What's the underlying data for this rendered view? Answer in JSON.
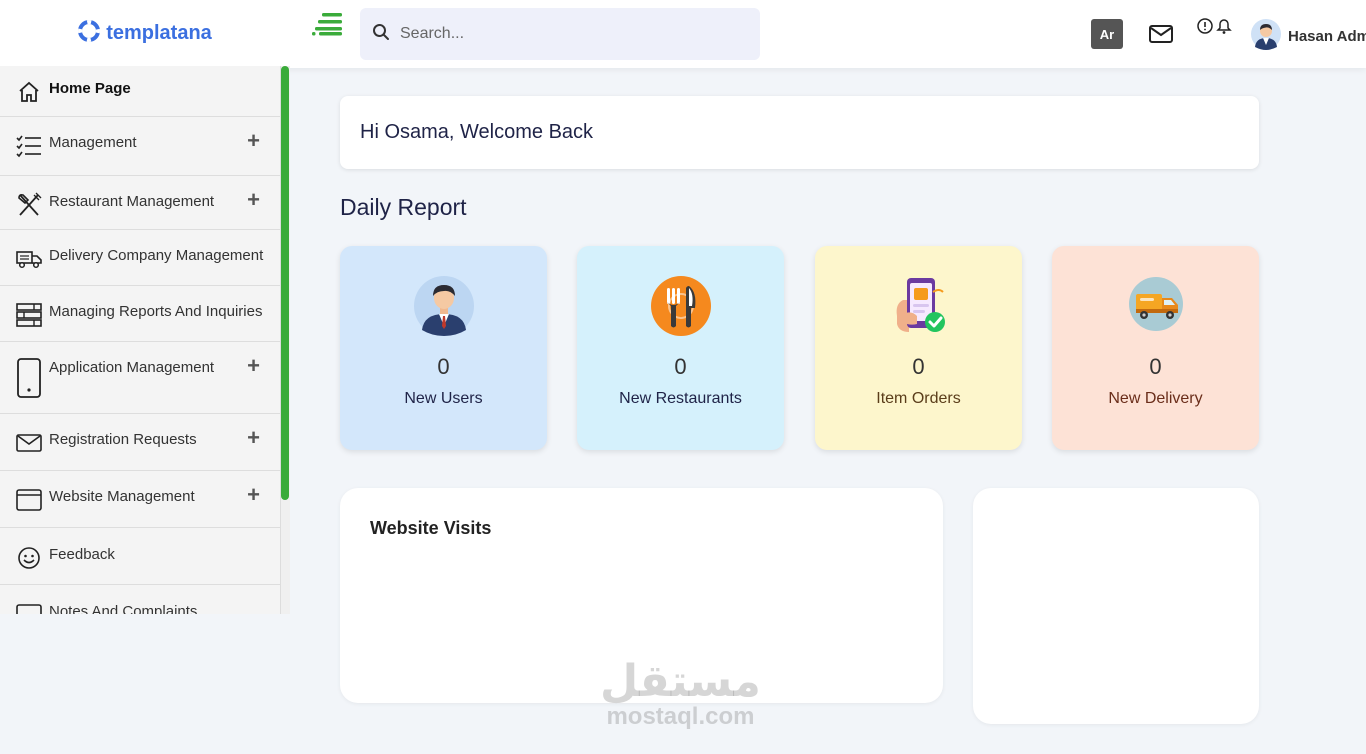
{
  "brand": {
    "name": "templatana",
    "color": "#3b6fe0"
  },
  "header": {
    "search_placeholder": "Search...",
    "lang_label": "Ar",
    "user_name": "Hasan Admin"
  },
  "sidebar": {
    "accent": "#3aab3a",
    "items": [
      {
        "label": "Home Page",
        "icon": "home-icon",
        "active": true,
        "expandable": false
      },
      {
        "label": "Management",
        "icon": "checklist-icon",
        "expandable": true
      },
      {
        "label": "Restaurant Management",
        "icon": "utensils-icon",
        "expandable": true
      },
      {
        "label": "Delivery Company Management",
        "icon": "truck-icon",
        "expandable": false
      },
      {
        "label": "Managing Reports And Inquiries",
        "icon": "server-icon",
        "expandable": false
      },
      {
        "label": "Application Management",
        "icon": "phone-icon",
        "expandable": true
      },
      {
        "label": "Registration Requests",
        "icon": "envelope-icon",
        "expandable": true
      },
      {
        "label": "Website Management",
        "icon": "browser-icon",
        "expandable": true
      },
      {
        "label": "Feedback",
        "icon": "smiley-icon",
        "expandable": false
      },
      {
        "label": "Notes And Complaints",
        "icon": "note-icon",
        "expandable": false
      }
    ]
  },
  "main": {
    "welcome": "Hi Osama, Welcome Back",
    "section_title": "Daily Report",
    "cards": [
      {
        "value": "0",
        "label": "New Users",
        "icon": "user-avatar-icon",
        "bg": "#d3e7fb",
        "label_color": "#1f2347"
      },
      {
        "value": "0",
        "label": "New Restaurants",
        "icon": "restaurant-icon",
        "bg": "#d5f1fc",
        "label_color": "#1f2347"
      },
      {
        "value": "0",
        "label": "Item Orders",
        "icon": "order-phone-icon",
        "bg": "#fdf6cc",
        "label_color": "#5a3d1a"
      },
      {
        "value": "0",
        "label": "New Delivery",
        "icon": "delivery-truck-icon",
        "bg": "#fde2d6",
        "label_color": "#6a2d1a"
      }
    ],
    "visits_title": "Website Visits"
  },
  "watermark": {
    "arabic": "مستقل",
    "latin": "mostaql.com"
  }
}
